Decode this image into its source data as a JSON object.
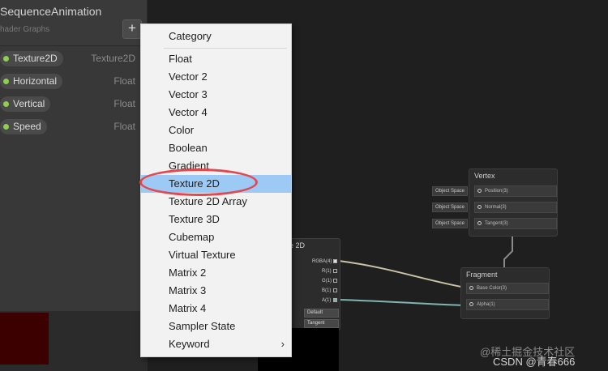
{
  "blackboard": {
    "title": "SequenceAnimation",
    "subtitle": "hader Graphs",
    "add_label": "+",
    "properties": [
      {
        "name": "Texture2D",
        "type": "Texture2D"
      },
      {
        "name": "Horizontal",
        "type": "Float"
      },
      {
        "name": "Vertical",
        "type": "Float"
      },
      {
        "name": "Speed",
        "type": "Float"
      }
    ]
  },
  "menu": {
    "header": "Category",
    "items": [
      "Float",
      "Vector 2",
      "Vector 3",
      "Vector 4",
      "Color",
      "Boolean",
      "Gradient",
      "Texture 2D",
      "Texture 2D Array",
      "Texture 3D",
      "Cubemap",
      "Virtual Texture",
      "Matrix 2",
      "Matrix 3",
      "Matrix 4",
      "Sampler State",
      "Keyword"
    ],
    "selected": "Texture 2D",
    "submenu_glyph": "›"
  },
  "vertex_node": {
    "title": "Vertex",
    "slots": [
      "Position(3)",
      "Normal(3)",
      "Tangent(3)"
    ],
    "side_tags": [
      "Object Space",
      "Object Space",
      "Object Space"
    ]
  },
  "fragment_node": {
    "title": "Fragment",
    "slots": [
      "Base Color(3)",
      "Alpha(1)"
    ]
  },
  "sample_node": {
    "title": "le 2D",
    "ports": [
      "RGBA(4)",
      "R(1)",
      "G(1)",
      "B(1)",
      "A(1)"
    ],
    "dropdowns": [
      "Default",
      "Tangent"
    ]
  },
  "watermark": {
    "line1": "@稀土掘金技术社区",
    "line2": "CSDN @青春666"
  },
  "colors": {
    "menu_bg": "#f2f2f2",
    "selected_bg": "#9ccaf5",
    "highlight_ring": "#e4484f",
    "property_dot": "#8fce4e"
  }
}
